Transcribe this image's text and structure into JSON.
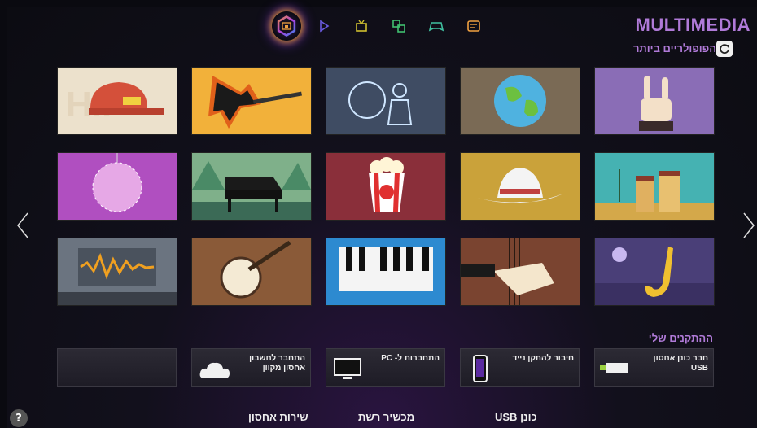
{
  "app": {
    "title": "MULTIMEDIA"
  },
  "popular": {
    "label": "הפופולריים ביותר",
    "refresh_icon": "refresh-icon"
  },
  "topnav": [
    {
      "icon": "multimedia-icon",
      "active": true
    },
    {
      "icon": "play-icon",
      "active": false
    },
    {
      "icon": "tv-icon",
      "active": false
    },
    {
      "icon": "apps-icon",
      "active": false
    },
    {
      "icon": "games-icon",
      "active": false
    },
    {
      "icon": "guide-icon",
      "active": false
    }
  ],
  "tiles": [
    {
      "theme": "hip-hop-cap",
      "bg": "#e9dcc6"
    },
    {
      "theme": "rock-guitar",
      "bg": "#f2b13a"
    },
    {
      "theme": "jazz-blues",
      "bg": "#3f4c63"
    },
    {
      "theme": "world-globe",
      "bg": "#7a6a55"
    },
    {
      "theme": "metal-hand",
      "bg": "#8a6db6"
    },
    {
      "theme": "disco-ball",
      "bg": "#b04fc0"
    },
    {
      "theme": "piano-forest",
      "bg": "#3b6a56"
    },
    {
      "theme": "popcorn-movie",
      "bg": "#8a2f3a"
    },
    {
      "theme": "country-hat",
      "bg": "#caa23a"
    },
    {
      "theme": "latin-drums",
      "bg": "#45b2b2"
    },
    {
      "theme": "audio-waveform",
      "bg": "#6b7480"
    },
    {
      "theme": "banjo",
      "bg": "#8a5a38"
    },
    {
      "theme": "keyboard",
      "bg": "#2d8ad0"
    },
    {
      "theme": "double-bass",
      "bg": "#6b3a28"
    },
    {
      "theme": "saxophone",
      "bg": "#4a3f78"
    }
  ],
  "devices": {
    "header": "ההתקנים שלי",
    "items": [
      {
        "label": "",
        "icon": ""
      },
      {
        "label": "התחבר לחשבון\nאחסון מקוון",
        "icon": "cloud-icon"
      },
      {
        "label": "התחברות ל- PC",
        "icon": "monitor-icon"
      },
      {
        "label": "חיבור להתקן נייד",
        "icon": "phone-icon"
      },
      {
        "label": "חבר כונן אחסון\nUSB",
        "icon": "usb-icon"
      }
    ]
  },
  "bottom_tabs": [
    "שירות אחסון",
    "מכשיר רשת",
    "כונן USB"
  ],
  "help": {
    "label": "?"
  },
  "colors": {
    "accent": "#b07ad8",
    "background": "#0c0c12"
  }
}
